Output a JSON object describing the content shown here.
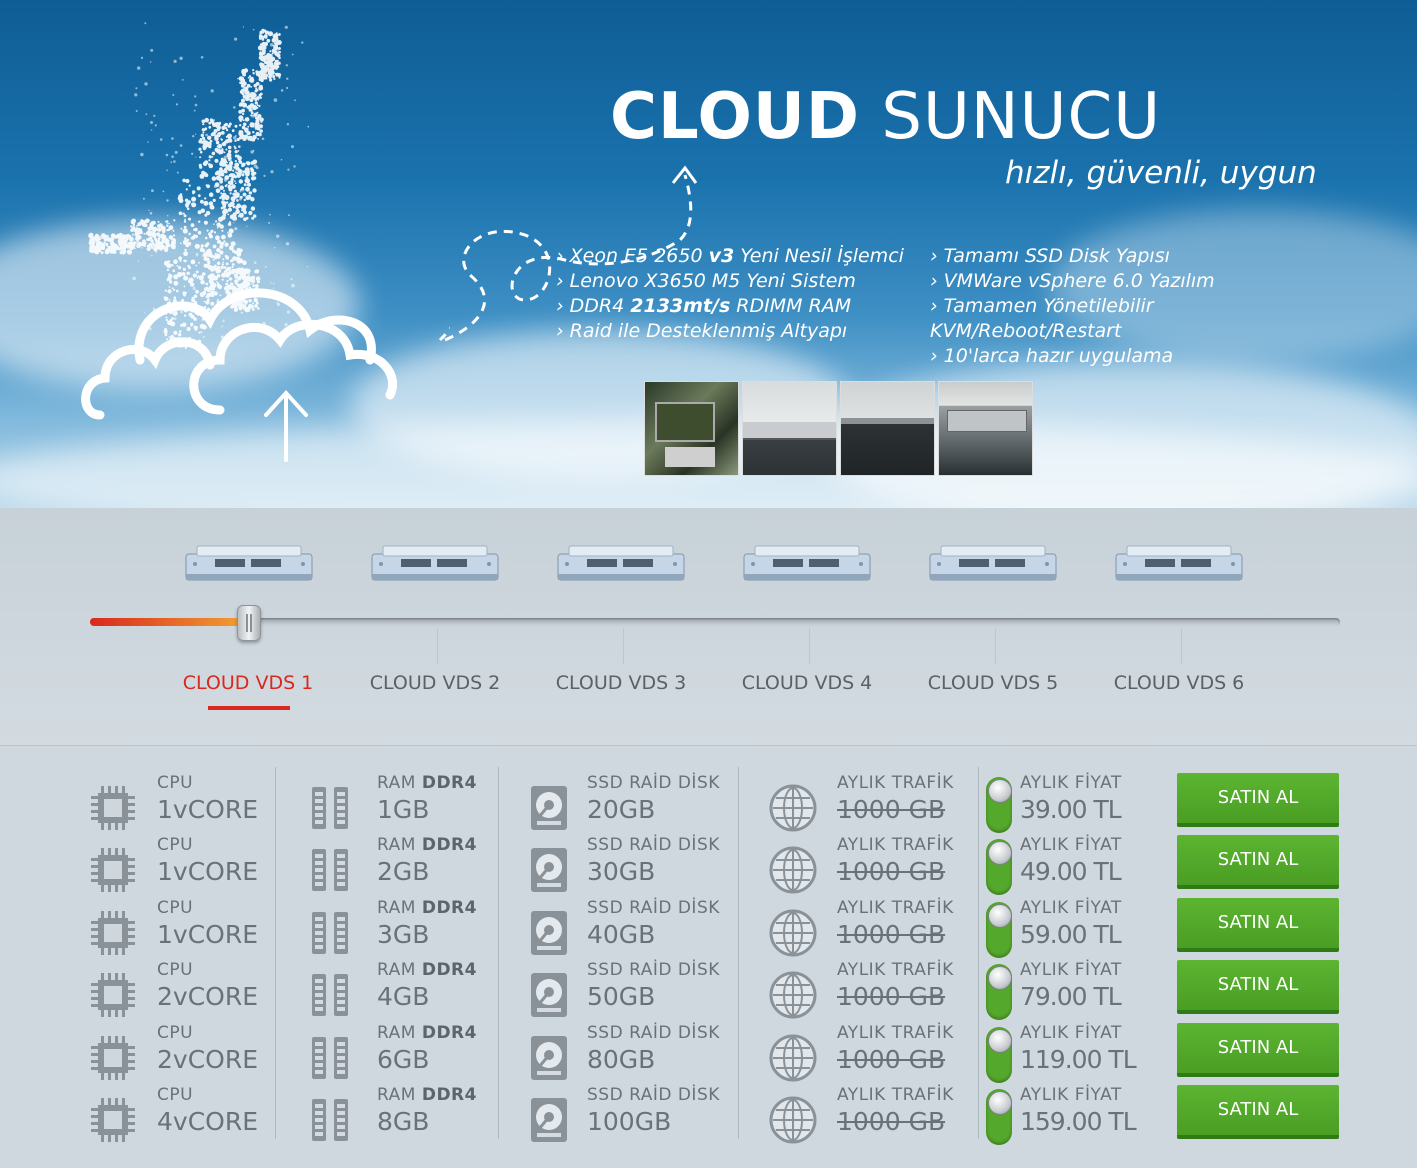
{
  "hero": {
    "title_bold": "CLOUD",
    "title_light": "SUNUCU",
    "subtitle": "hızlı, güvenli, uygun",
    "features_left": [
      {
        "pre": "Xeon E5 2650 ",
        "bold": "v3",
        "post": " Yeni Nesil İşlemci"
      },
      {
        "pre": "Lenovo X3650 M5 Yeni Sistem",
        "bold": "",
        "post": ""
      },
      {
        "pre": "DDR4 ",
        "bold": "2133mt/s",
        "post": " RDIMM RAM"
      },
      {
        "pre": "Raid ile Desteklenmiş Altyapı",
        "bold": "",
        "post": ""
      }
    ],
    "features_right": [
      "Tamamı SSD Disk Yapısı",
      "VMWare vSphere 6.0 Yazılım",
      "Tamamen Yönetilebilir",
      "KVM/Reboot/Restart",
      "10'larca hazır uygulama"
    ],
    "bullet": "›"
  },
  "slider": {
    "tabs": [
      "CLOUD VDS 1",
      "CLOUD VDS 2",
      "CLOUD VDS 3",
      "CLOUD VDS 4",
      "CLOUD VDS 5",
      "CLOUD VDS 6"
    ],
    "active_index": 0,
    "colors": {
      "active": "#d9281e",
      "fill_start": "#d9281e",
      "fill_end": "#f2a530"
    }
  },
  "plans": [
    {
      "cpu_label": "CPU",
      "cpu": "1vCORE",
      "ram_label": "RAM",
      "ram_type": "DDR4",
      "ram": "1GB",
      "disk_label": "SSD RAİD DİSK",
      "disk": "20GB",
      "traffic_label": "AYLIK TRAFİK",
      "traffic": "1000 GB",
      "price_label": "AYLIK FİYAT",
      "price": "39.00 TL",
      "buy": "SATIN AL"
    },
    {
      "cpu_label": "CPU",
      "cpu": "1vCORE",
      "ram_label": "RAM",
      "ram_type": "DDR4",
      "ram": "2GB",
      "disk_label": "SSD RAİD DİSK",
      "disk": "30GB",
      "traffic_label": "AYLIK TRAFİK",
      "traffic": "1000 GB",
      "price_label": "AYLIK FİYAT",
      "price": "49.00 TL",
      "buy": "SATIN AL"
    },
    {
      "cpu_label": "CPU",
      "cpu": "1vCORE",
      "ram_label": "RAM",
      "ram_type": "DDR4",
      "ram": "3GB",
      "disk_label": "SSD RAİD DİSK",
      "disk": "40GB",
      "traffic_label": "AYLIK TRAFİK",
      "traffic": "1000 GB",
      "price_label": "AYLIK FİYAT",
      "price": "59.00 TL",
      "buy": "SATIN AL"
    },
    {
      "cpu_label": "CPU",
      "cpu": "2vCORE",
      "ram_label": "RAM",
      "ram_type": "DDR4",
      "ram": "4GB",
      "disk_label": "SSD RAİD DİSK",
      "disk": "50GB",
      "traffic_label": "AYLIK TRAFİK",
      "traffic": "1000 GB",
      "price_label": "AYLIK FİYAT",
      "price": "79.00 TL",
      "buy": "SATIN AL"
    },
    {
      "cpu_label": "CPU",
      "cpu": "2vCORE",
      "ram_label": "RAM",
      "ram_type": "DDR4",
      "ram": "6GB",
      "disk_label": "SSD RAİD DİSK",
      "disk": "80GB",
      "traffic_label": "AYLIK TRAFİK",
      "traffic": "1000 GB",
      "price_label": "AYLIK FİYAT",
      "price": "119.00 TL",
      "buy": "SATIN AL"
    },
    {
      "cpu_label": "CPU",
      "cpu": "4vCORE",
      "ram_label": "RAM",
      "ram_type": "DDR4",
      "ram": "8GB",
      "disk_label": "SSD RAİD DİSK",
      "disk": "100GB",
      "traffic_label": "AYLIK TRAFİK",
      "traffic": "1000 GB",
      "price_label": "AYLIK FİYAT",
      "price": "159.00 TL",
      "buy": "SATIN AL"
    }
  ],
  "icons": {
    "cpu": "cpu-chip-icon",
    "ram": "ram-module-icon",
    "disk": "hard-disk-icon",
    "traffic": "globe-icon",
    "price": "toggle-switch-icon",
    "server": "server-rack-icon"
  },
  "colors": {
    "buy_button": "#4fa827",
    "accent_red": "#d9281e",
    "hero_blue": "#1a72ad"
  }
}
